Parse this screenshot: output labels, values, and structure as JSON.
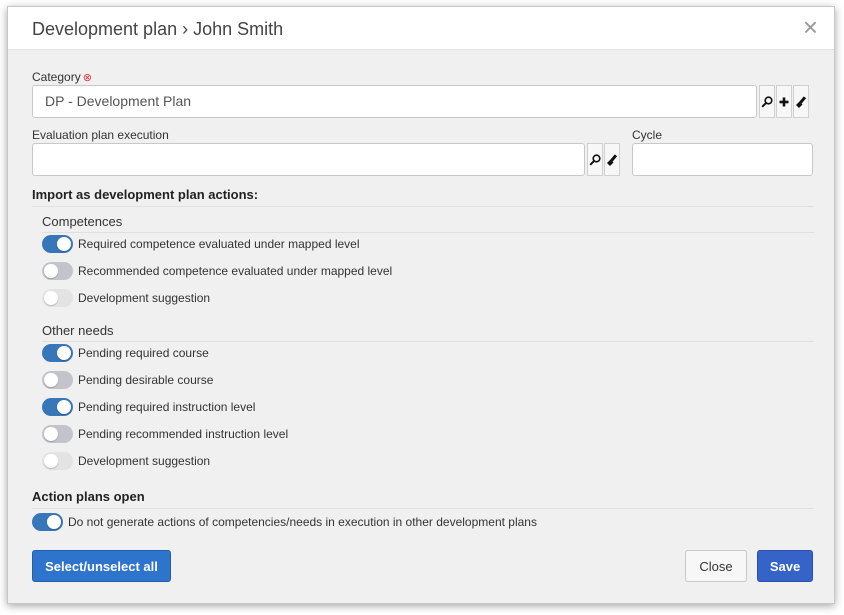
{
  "dialog": {
    "title": "Development plan › John Smith",
    "close_glyph": "×"
  },
  "fields": {
    "category": {
      "label": "Category",
      "required_mark": "⊗",
      "value": "DP - Development Plan",
      "icons": [
        "search-icon",
        "add-icon",
        "clear-icon"
      ]
    },
    "evaluation_plan_execution": {
      "label": "Evaluation plan execution",
      "value": "",
      "icons": [
        "search-icon",
        "clear-icon"
      ]
    },
    "cycle": {
      "label": "Cycle",
      "value": ""
    }
  },
  "import_section": {
    "title": "Import as development plan actions:",
    "competences": {
      "title": "Competences",
      "items": [
        {
          "label": "Required competence evaluated under mapped level",
          "state": "on"
        },
        {
          "label": "Recommended competence evaluated under mapped level",
          "state": "off"
        },
        {
          "label": "Development suggestion",
          "state": "disabled"
        }
      ]
    },
    "other_needs": {
      "title": "Other needs",
      "items": [
        {
          "label": "Pending required course",
          "state": "on"
        },
        {
          "label": "Pending desirable course",
          "state": "off"
        },
        {
          "label": "Pending required instruction level",
          "state": "on"
        },
        {
          "label": "Pending recommended instruction level",
          "state": "off"
        },
        {
          "label": "Development suggestion",
          "state": "disabled"
        }
      ]
    }
  },
  "action_plans": {
    "title": "Action plans open",
    "item": {
      "label": "Do not generate actions of competencies/needs in execution in other development plans",
      "state": "on"
    }
  },
  "footer": {
    "select_all_label": "Select/unselect all",
    "close_label": "Close",
    "save_label": "Save"
  },
  "colors": {
    "toggle_on": "#3776b8",
    "toggle_off": "#c3c4cb",
    "toggle_disabled": "#e3e3e3",
    "primary_button": "#2e74cc",
    "save_button": "#3663c7",
    "required_mark": "#d93a3a"
  }
}
